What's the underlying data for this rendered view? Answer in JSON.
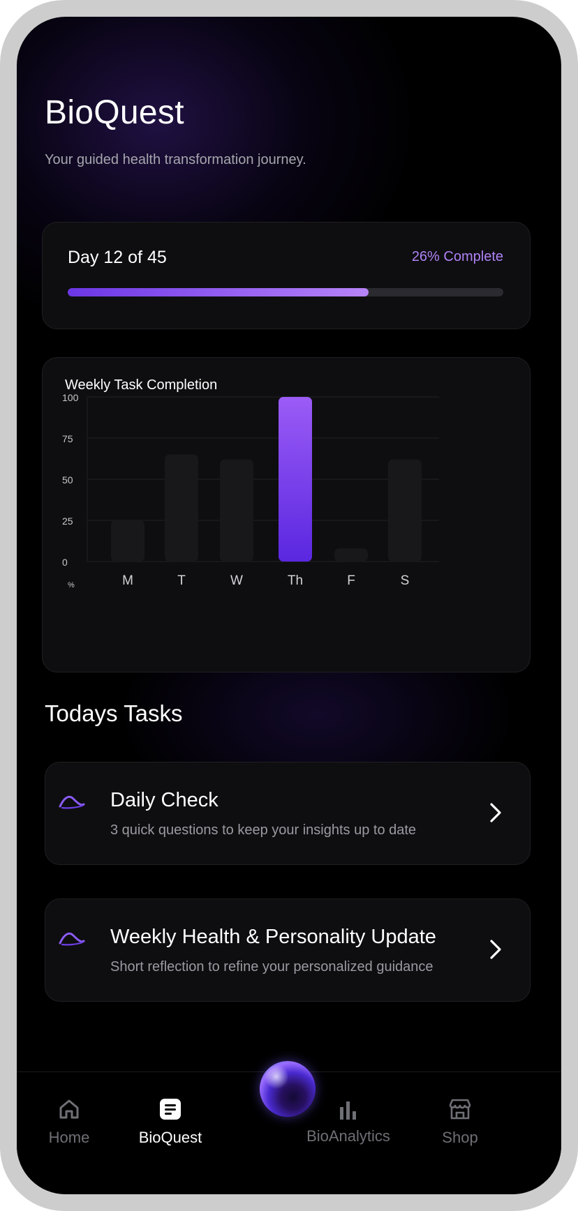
{
  "app": {
    "title": "BioQuest",
    "subtitle": "Your guided health transformation journey."
  },
  "progress": {
    "day_label": "Day 12 of 45",
    "percent_label": "26% Complete",
    "bar_fill_fraction": 0.69
  },
  "chart_data": {
    "type": "bar",
    "title": "Weekly Task Completion",
    "categories": [
      "M",
      "T",
      "W",
      "Th",
      "F",
      "S"
    ],
    "values": [
      25,
      65,
      62,
      100,
      8,
      62
    ],
    "highlight_index": 3,
    "ylabel": "%",
    "ylim": [
      0,
      100
    ],
    "yticks": [
      "100",
      "75",
      "50",
      "25",
      "0"
    ],
    "ytick_values": [
      100,
      75,
      50,
      25,
      0
    ],
    "grid": true,
    "colors": {
      "bar": "#18181b",
      "highlight_top": "#9b5cf6",
      "highlight_bottom": "#5a27e0"
    }
  },
  "tasks": {
    "section_title": "Todays Tasks",
    "items": [
      {
        "title": "Daily Check",
        "description": "3 quick questions to keep your insights up to date",
        "icon": "wave-icon"
      },
      {
        "title": "Weekly Health & Personality Update",
        "description": "Short reflection to refine your personalized guidance",
        "icon": "wave-icon"
      }
    ]
  },
  "nav": {
    "items": [
      {
        "label": "Home",
        "icon": "home-icon"
      },
      {
        "label": "BioQuest",
        "icon": "document-icon",
        "active": true
      },
      {
        "label": "",
        "icon": "orb-icon"
      },
      {
        "label": "BioAnalytics",
        "icon": "bar-chart-icon"
      },
      {
        "label": "Shop",
        "icon": "store-icon"
      }
    ]
  },
  "colors": {
    "accent": "#b082f5",
    "background": "#000000",
    "card": "#0e0e10"
  }
}
